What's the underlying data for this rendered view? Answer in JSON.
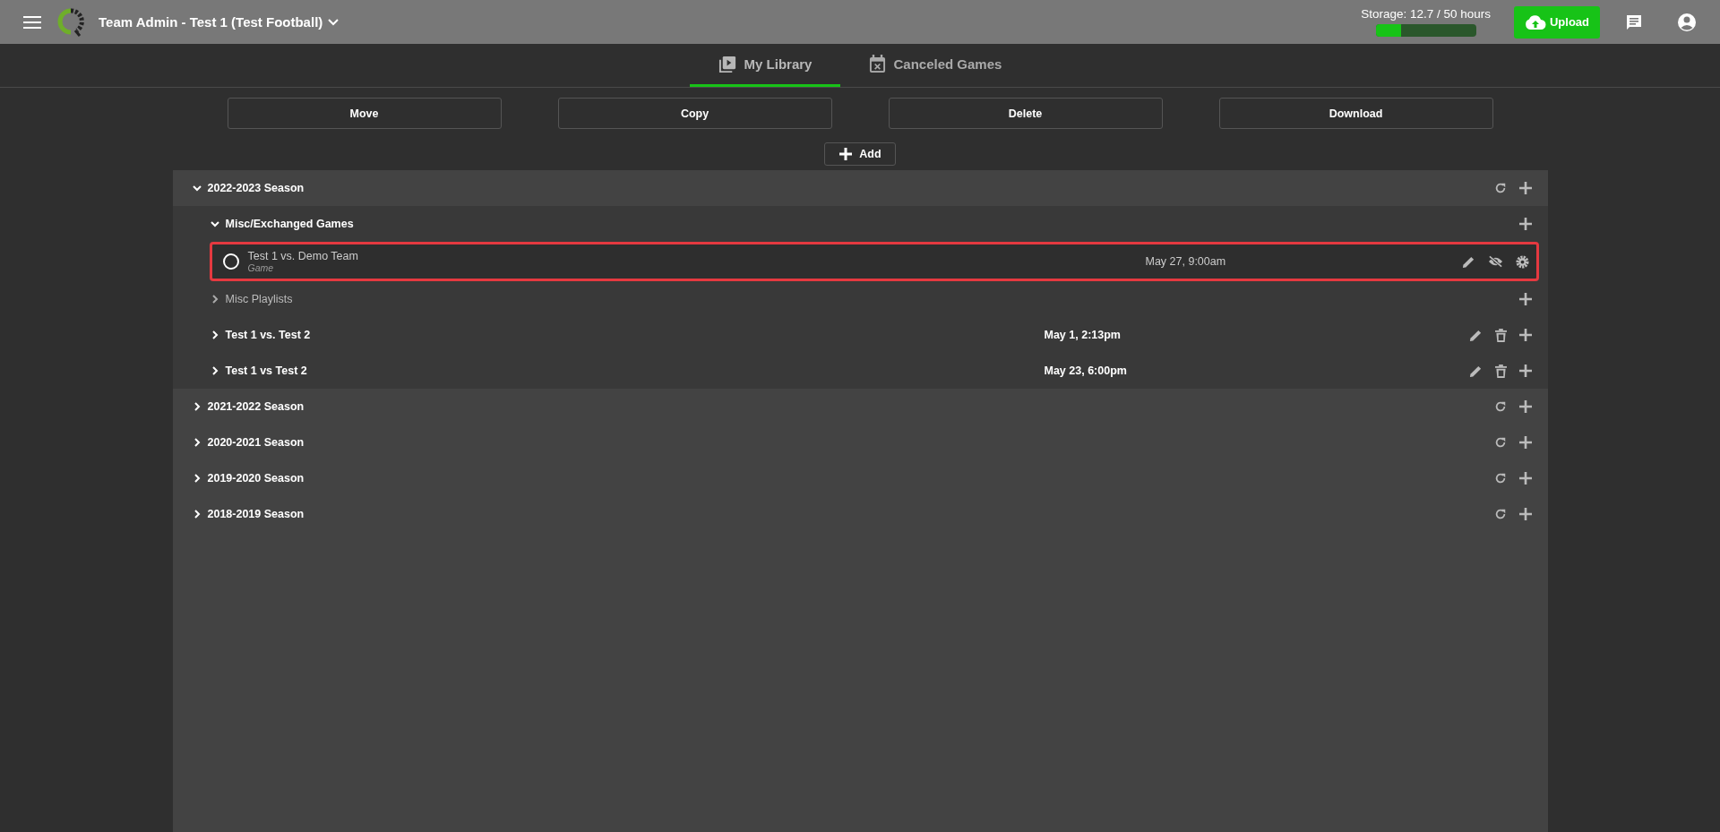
{
  "header": {
    "title": "Team Admin - Test 1 (Test Football)",
    "storage": {
      "label": "Storage: 12.7 / 50 hours",
      "level": 0.254
    },
    "upload_button": "Upload"
  },
  "tabs": [
    {
      "label": "My Library",
      "kind": "library",
      "selected": true
    },
    {
      "label": "Canceled Games",
      "kind": "canceled",
      "selected": false
    }
  ],
  "actions": [
    "Move",
    "Copy",
    "Delete",
    "Download"
  ],
  "add_button": "Add",
  "seasons": [
    {
      "label": "2022-2023 Season",
      "expanded": true,
      "children": [
        {
          "kind": "folder",
          "label": "Misc/Exchanged Games",
          "expanded": true,
          "dimmed": false,
          "children": [
            {
              "title": "Test 1 vs. Demo Team",
              "subtitle": "Game",
              "date": "May 27, 9:00am",
              "checked": false,
              "highlighted": true,
              "hidden": true
            }
          ]
        },
        {
          "kind": "folder",
          "label": "Misc Playlists",
          "expanded": false,
          "dimmed": true
        },
        {
          "kind": "event",
          "label": "Test 1 vs. Test 2",
          "date": "May 1, 2:13pm",
          "expanded": false
        },
        {
          "kind": "event",
          "label": "Test 1 vs Test 2",
          "date": "May 23, 6:00pm",
          "expanded": false
        }
      ]
    },
    {
      "label": "2021-2022 Season",
      "expanded": false
    },
    {
      "label": "2020-2021 Season",
      "expanded": false
    },
    {
      "label": "2019-2020 Season",
      "expanded": false
    },
    {
      "label": "2018-2019 Season",
      "expanded": false
    }
  ]
}
